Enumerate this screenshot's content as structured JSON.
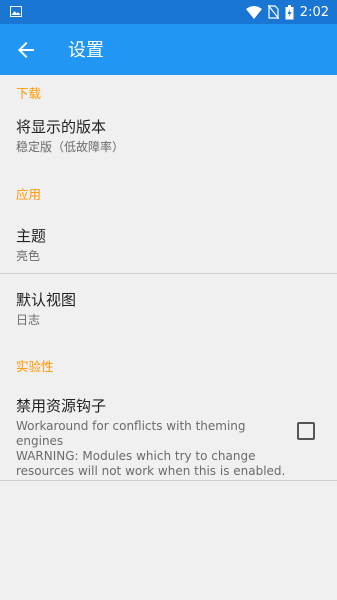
{
  "status_bar": {
    "time": "2:02",
    "icons": [
      "image-icon",
      "wifi-icon",
      "no-sim-icon",
      "battery-icon"
    ]
  },
  "app_bar": {
    "title": "设置",
    "back_icon": "arrow-back-icon"
  },
  "sections": {
    "download": {
      "header": "下载",
      "version_pref": {
        "title": "将显示的版本",
        "summary": "稳定版（低故障率）"
      }
    },
    "app": {
      "header": "应用",
      "theme_pref": {
        "title": "主题",
        "summary": "亮色"
      },
      "default_view_pref": {
        "title": "默认视图",
        "summary": "日志"
      }
    },
    "experimental": {
      "header": "实验性",
      "disable_hooks_pref": {
        "title": "禁用资源钩子",
        "summary_line1": "Workaround for conflicts with theming",
        "summary_line2": "engines",
        "summary_line3": "WARNING: Modules which try to change",
        "summary_line4": "resources will not work when this is enabled.",
        "checked": false
      }
    }
  },
  "colors": {
    "status_bar": "#1976d2",
    "app_bar": "#2196f3",
    "category_header": "#ff9800",
    "background": "#f0f0f0"
  }
}
